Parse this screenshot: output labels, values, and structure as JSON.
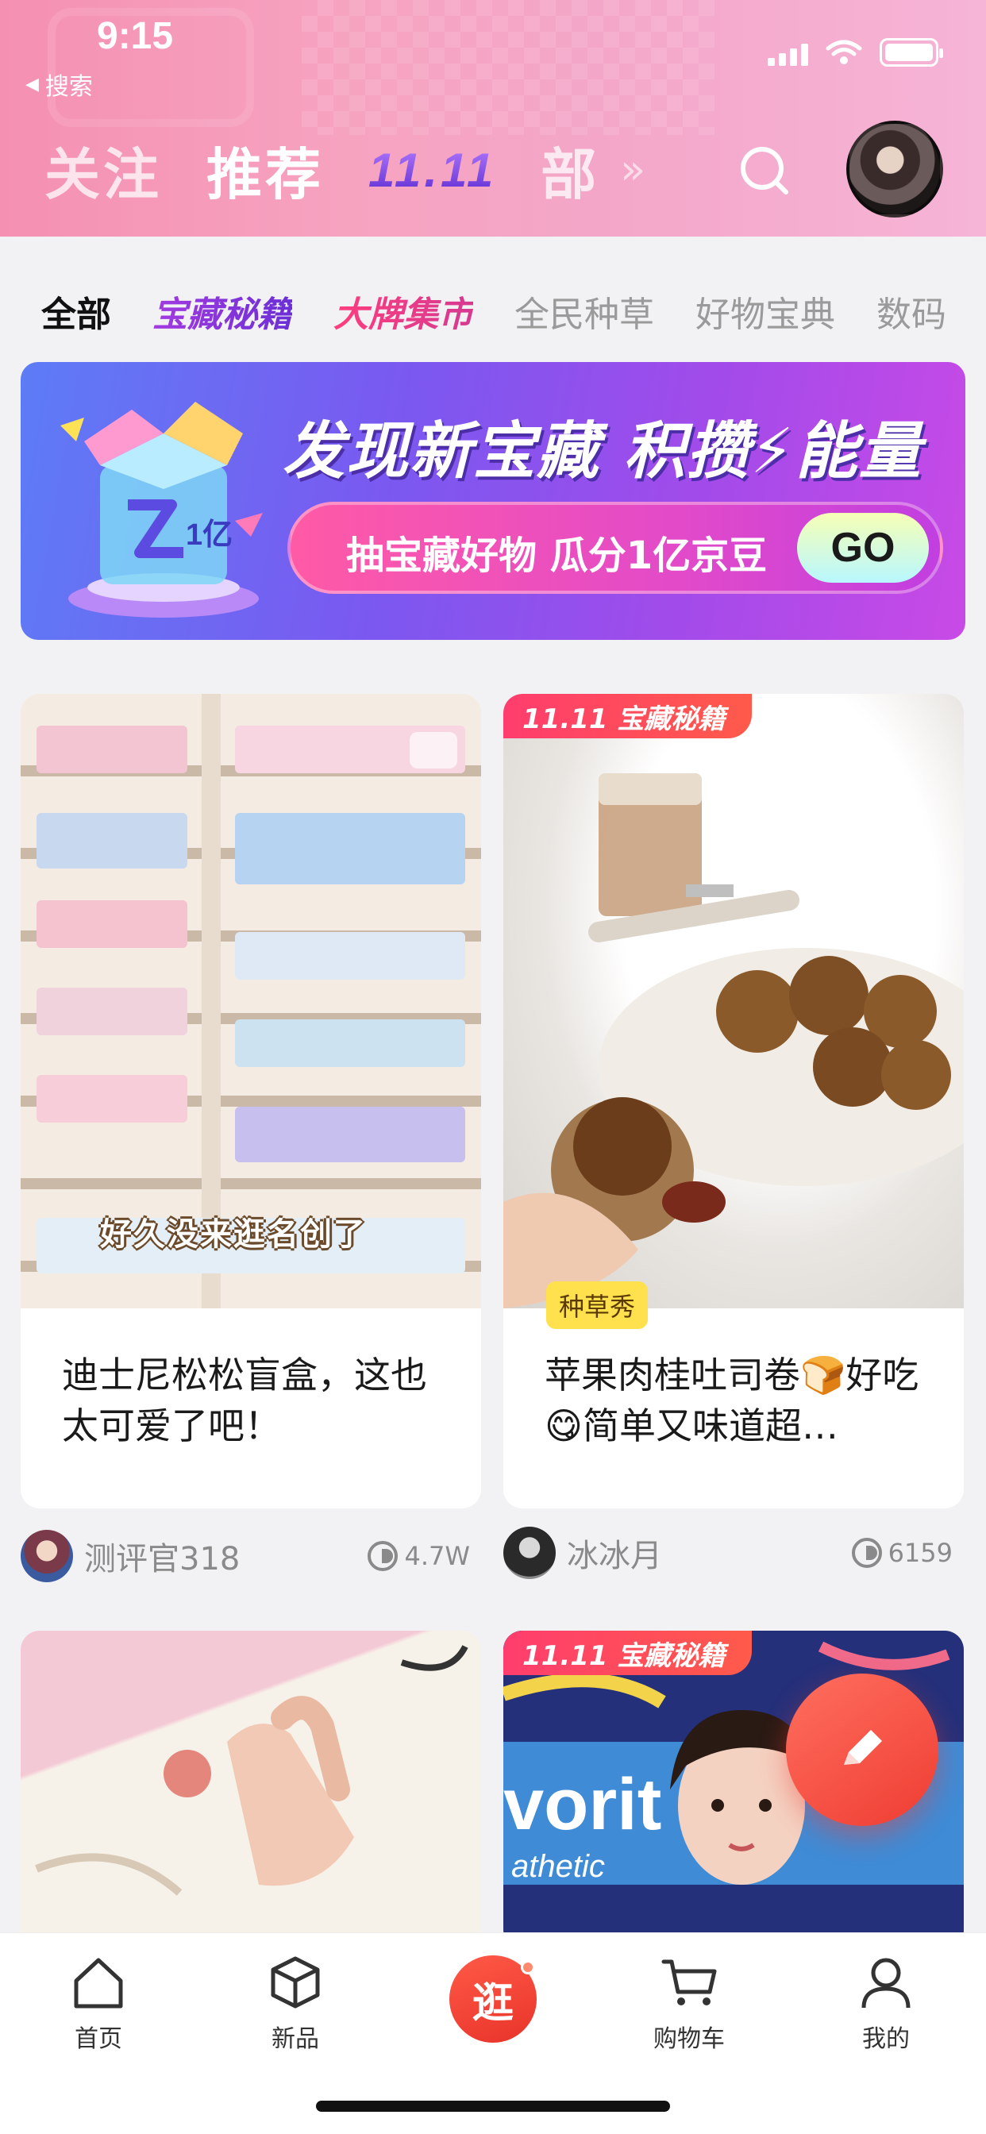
{
  "status_bar": {
    "time": "9:15",
    "back_app": "搜索"
  },
  "header": {
    "tabs": [
      {
        "label": "关注",
        "active": false
      },
      {
        "label": "推荐",
        "active": true
      },
      {
        "label": "11.11",
        "active": false
      },
      {
        "label": "部",
        "active": false
      }
    ],
    "more": "»"
  },
  "categories": [
    {
      "label": "全部",
      "active": true
    },
    {
      "label": "宝藏秘籍",
      "style": "special1"
    },
    {
      "label": "大牌集市",
      "style": "special2"
    },
    {
      "label": "全民种草"
    },
    {
      "label": "好物宝典"
    },
    {
      "label": "数码"
    }
  ],
  "banner": {
    "title": "发现新宝藏 积攒⚡能量",
    "subtitle": "抽宝藏好物 瓜分1亿京豆",
    "cta": "GO",
    "box_label": "1亿"
  },
  "feed": [
    {
      "overlay_text": "好久没来逛名创了",
      "title": "迪士尼松松盲盒，这也太可爱了吧！",
      "author": "测评官318",
      "views": "4.7W"
    },
    {
      "event_badge": "11.11 宝藏秘籍",
      "tag": "种草秀",
      "title": "苹果肉桂吐司卷🍞好吃😋简单又味道超…",
      "author": "冰冰月",
      "views": "6159"
    },
    {
      "title": ""
    },
    {
      "event_badge": "11.11 宝藏秘籍",
      "poster_text": "vorit",
      "poster_text2": "athetic"
    }
  ],
  "bottom_nav": [
    {
      "label": "首页",
      "icon": "home-icon"
    },
    {
      "label": "新品",
      "icon": "cube-icon"
    },
    {
      "label": "逛",
      "icon": "guang-icon"
    },
    {
      "label": "购物车",
      "icon": "cart-icon"
    },
    {
      "label": "我的",
      "icon": "profile-icon"
    }
  ],
  "colors": {
    "accent": "#ef3d33",
    "header_pink": "#f6a3c0",
    "banner_purple": "#7b58f0",
    "tag_yellow": "#ffe04d"
  }
}
